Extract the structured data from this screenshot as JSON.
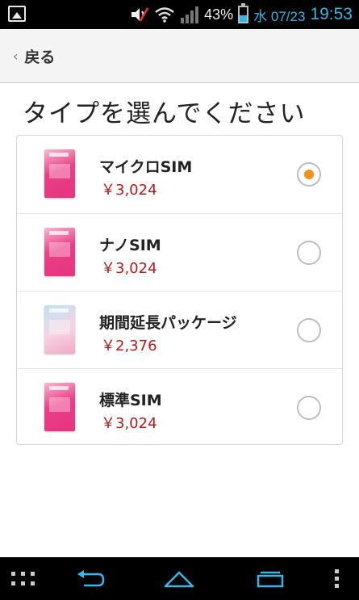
{
  "status_bar": {
    "battery_percent": "43%",
    "battery_level": 0.43,
    "date": "水 07/23",
    "time": "19:53",
    "icons": [
      "image-icon",
      "mute-icon",
      "wifi-icon",
      "signal-icon",
      "battery-icon"
    ]
  },
  "header": {
    "back_label": "戻る"
  },
  "page": {
    "title": "タイプを選んでください"
  },
  "sim_options": [
    {
      "name": "マイクロSIM",
      "price": "￥3,024",
      "selected": true,
      "thumb": "pink"
    },
    {
      "name": "ナノSIM",
      "price": "￥3,024",
      "selected": false,
      "thumb": "pink"
    },
    {
      "name": "期間延長パッケージ",
      "price": "￥2,376",
      "selected": false,
      "thumb": "blue"
    },
    {
      "name": "標準SIM",
      "price": "￥3,024",
      "selected": false,
      "thumb": "pink"
    }
  ],
  "colors": {
    "accent_orange": "#f39019",
    "price_red": "#b31b1b",
    "status_blue": "#33b5e5"
  },
  "nav_bar": {
    "icons": [
      "apps-grid-icon",
      "back-icon",
      "home-icon",
      "recent-apps-icon",
      "menu-icon"
    ]
  }
}
